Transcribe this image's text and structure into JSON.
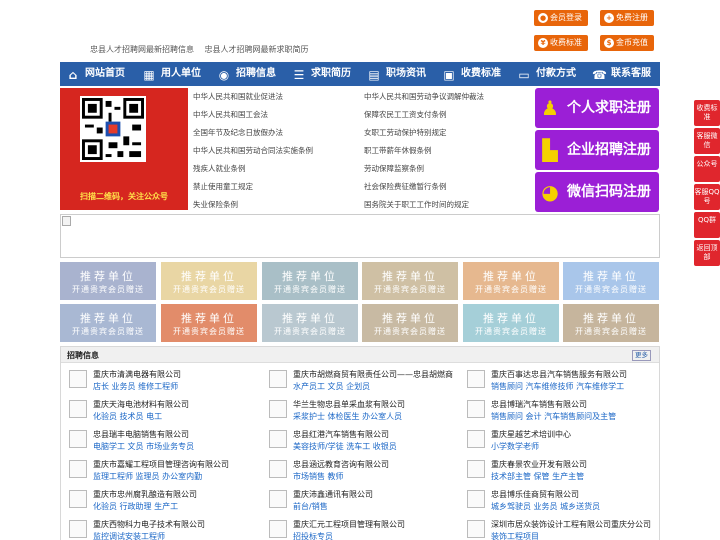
{
  "header": {
    "links": [
      "忠县人才招聘网最新招聘信息",
      "忠县人才招聘网最新求职简历"
    ],
    "buttons": [
      {
        "label": "会员登录",
        "icon": "user-icon"
      },
      {
        "label": "免费注册",
        "icon": "user-plus-icon"
      },
      {
        "label": "收费标准",
        "icon": "yuan-icon"
      },
      {
        "label": "金币充值",
        "icon": "coin-icon"
      }
    ]
  },
  "nav": [
    {
      "label": "网站首页",
      "icon": "home-icon"
    },
    {
      "label": "用人单位",
      "icon": "building-icon"
    },
    {
      "label": "招聘信息",
      "icon": "megaphone-icon"
    },
    {
      "label": "求职简历",
      "icon": "resume-icon"
    },
    {
      "label": "职场资讯",
      "icon": "news-icon"
    },
    {
      "label": "收费标准",
      "icon": "price-icon"
    },
    {
      "label": "付款方式",
      "icon": "card-icon"
    },
    {
      "label": "联系客服",
      "icon": "phone-icon"
    }
  ],
  "qr": {
    "caption": "扫描二维码，关注公众号"
  },
  "laws_left": [
    "中华人民共和国就业促进法",
    "中华人民共和国工会法",
    "全国年节及纪念日放假办法",
    "中华人民共和国劳动合同法实施条例",
    "残疾人就业条例",
    "禁止使用童工规定",
    "失业保险条例"
  ],
  "laws_right": [
    "中华人民共和国劳动争议调解仲裁法",
    "保障农民工工资支付条例",
    "女职工劳动保护特别规定",
    "职工带薪年休假条例",
    "劳动保障监察条例",
    "社会保险费征缴暂行条例",
    "国务院关于职工工作时间的规定"
  ],
  "register": [
    {
      "label": "个人求职注册",
      "icon": "person-icon"
    },
    {
      "label": "企业招聘注册",
      "icon": "company-icon"
    },
    {
      "label": "微信扫码注册",
      "icon": "wechat-icon"
    }
  ],
  "tiles": {
    "title": "推荐单位",
    "subtitle": "开通贵宾会员赠送",
    "colors": [
      "#a9b3cf",
      "#e9d6a4",
      "#a9bfc7",
      "#cfc0a4",
      "#e6b88f",
      "#a9c6ea",
      "#a9b8d3",
      "#e28c6a",
      "#b9c8d0",
      "#c8baa3",
      "#a5cfd8",
      "#c6b59d"
    ]
  },
  "jobs": {
    "title": "招聘信息",
    "more": "更多",
    "items": [
      {
        "company": "重庆市清满电器有限公司",
        "positions": "店长 业务员 维修工程师"
      },
      {
        "company": "重庆市胡燃商贸有限责任公司——忠县胡燃商",
        "positions": "水产员工 文员 企划员"
      },
      {
        "company": "重庆百事达忠县汽车销售服务有限公司",
        "positions": "销售顾问 汽车维修技师 汽车维修学工"
      },
      {
        "company": "重庆天海电池材料有限公司",
        "positions": "化验员 技术员 电工"
      },
      {
        "company": "华兰生物忠县单采血浆有限公司",
        "positions": "采浆护士 体检医生 办公室人员"
      },
      {
        "company": "忠县博瑞汽车销售有限公司",
        "positions": "销售顾问 会计 汽车销售顾问及主管"
      },
      {
        "company": "忠县瑞丰电脑销售有限公司",
        "positions": "电脑学工 文员 市场业务专员"
      },
      {
        "company": "忠县红港汽车销售有限公司",
        "positions": "美容技师/学徒 洗车工 收银员"
      },
      {
        "company": "重庆星越艺术培训中心",
        "positions": "小学数学老师"
      },
      {
        "company": "重庆市嘉耀工程项目管理咨询有限公司",
        "positions": "监理工程师 监理员 办公室内勤"
      },
      {
        "company": "忠县涵远教育咨询有限公司",
        "positions": "市场销售 教师"
      },
      {
        "company": "重庆春景农业开发有限公司",
        "positions": "技术部主管 保管 生产主管"
      },
      {
        "company": "重庆市忠州腐乳酿造有限公司",
        "positions": "化验员 行政助理 生产工"
      },
      {
        "company": "重庆沛鑫通讯有限公司",
        "positions": "前台/销售"
      },
      {
        "company": "忠县博乐佳商贸有限公司",
        "positions": "城乡驾驶员 业务员 城乡送货员"
      },
      {
        "company": "重庆西物科力电子技术有限公司",
        "positions": "监控调试安装工程师"
      },
      {
        "company": "重庆汇元工程项目管理有限公司",
        "positions": "招投标专员"
      },
      {
        "company": "深圳市居众装饰设计工程有限公司重庆分公司",
        "positions": "装饰工程项目"
      }
    ]
  },
  "float": [
    {
      "label": "收费标准"
    },
    {
      "label": "客服微信"
    },
    {
      "label": "公众号"
    },
    {
      "label": "客服QQ号"
    },
    {
      "label": "QQ群"
    },
    {
      "label": "返回顶部"
    }
  ]
}
